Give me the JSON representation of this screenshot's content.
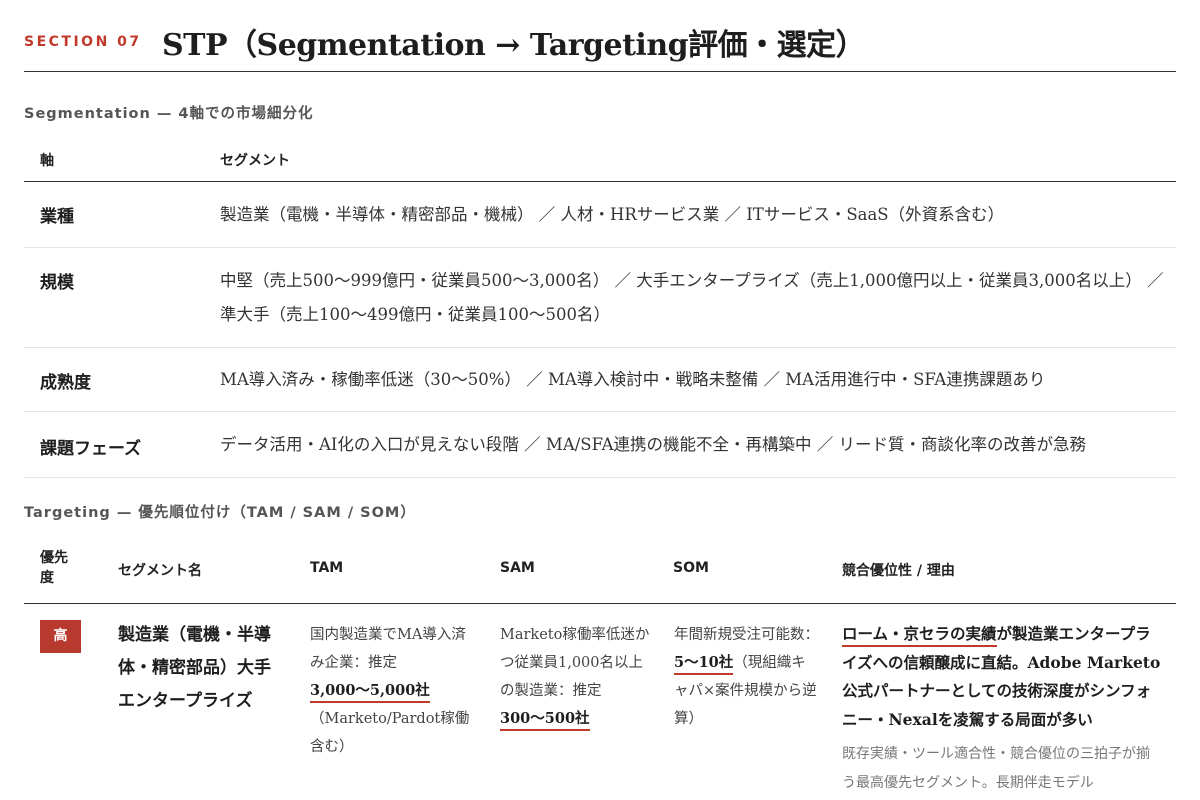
{
  "header": {
    "section_number": "SECTION 07",
    "title": "STP（Segmentation → Targeting評価・選定）"
  },
  "segmentation": {
    "heading": "Segmentation — 4軸での市場細分化",
    "columns": [
      "軸",
      "セグメント"
    ],
    "rows": [
      {
        "axis": "業種",
        "value": "製造業（電機・半導体・精密部品・機械） ／ 人材・HRサービス業 ／ ITサービス・SaaS（外資系含む）"
      },
      {
        "axis": "規模",
        "value": "中堅（売上500〜999億円・従業員500〜3,000名） ／ 大手エンタープライズ（売上1,000億円以上・従業員3,000名以上） ／ 準大手（売上100〜499億円・従業員100〜500名）"
      },
      {
        "axis": "成熟度",
        "value": "MA導入済み・稼働率低迷（30〜50%） ／ MA導入検討中・戦略未整備 ／ MA活用進行中・SFA連携課題あり"
      },
      {
        "axis": "課題フェーズ",
        "value": "データ活用・AI化の入口が見えない段階 ／ MA/SFA連携の機能不全・再構築中 ／ リード質・商談化率の改善が急務"
      }
    ]
  },
  "targeting": {
    "heading": "Targeting — 優先順位付け（TAM / SAM / SOM）",
    "columns": {
      "priority": "優先度",
      "name": "セグメント名",
      "tam": "TAM",
      "sam": "SAM",
      "som": "SOM",
      "competitive": "競合優位性 / 理由"
    },
    "rows": [
      {
        "priority": "高",
        "name": "製造業（電機・半導体・精密部品）大手エンタープライズ",
        "tam_pre": "国内製造業でMA導入済み企業：推定",
        "tam_value": "3,000〜5,000社",
        "tam_post": "（Marketo/Pardot稼働含む）",
        "sam_pre": "Marketo稼働率低迷かつ従業員1,000名以上の製造業：推定",
        "sam_value": "300〜500社",
        "som_pre": "年間新規受注可能数：",
        "som_value": "5〜10社",
        "som_post": "（現組織キャパ×案件規模から逆算）",
        "comp_highlight": "ローム・京セラの実績",
        "comp_text": "が製造業エンタープライズへの信頼醸成に直結。Adobe Marketo公式パートナーとしての技術深度がシンフォニー・Nexalを凌駕する局面が多い",
        "comp_note": "既存実績・ツール適合性・競合優位の三拍子が揃う最高優先セグメント。長期伴走モデル"
      }
    ]
  }
}
